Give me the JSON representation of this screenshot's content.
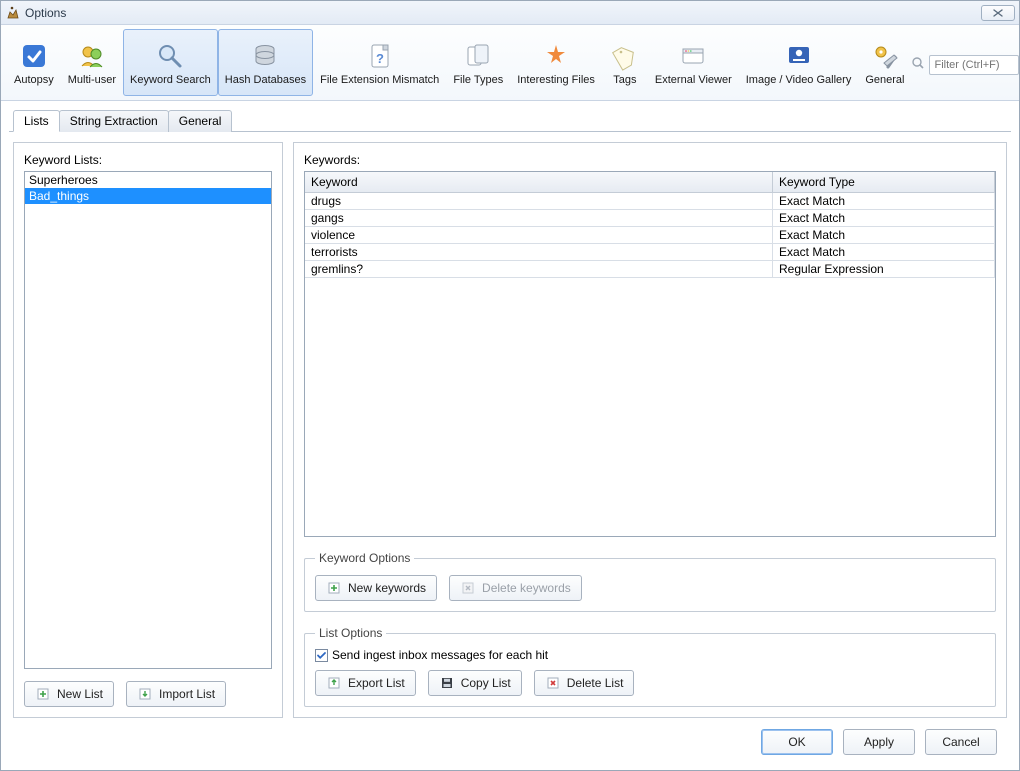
{
  "window": {
    "title": "Options"
  },
  "toolbar": {
    "items": [
      {
        "id": "autopsy",
        "label": "Autopsy"
      },
      {
        "id": "multi-user",
        "label": "Multi-user"
      },
      {
        "id": "keyword-search",
        "label": "Keyword Search"
      },
      {
        "id": "hash-databases",
        "label": "Hash Databases"
      },
      {
        "id": "file-ext-mismatch",
        "label": "File Extension Mismatch"
      },
      {
        "id": "file-types",
        "label": "File Types"
      },
      {
        "id": "interesting-files",
        "label": "Interesting Files"
      },
      {
        "id": "tags",
        "label": "Tags"
      },
      {
        "id": "external-viewer",
        "label": "External Viewer"
      },
      {
        "id": "image-video-gallery",
        "label": "Image / Video Gallery"
      },
      {
        "id": "general",
        "label": "General"
      }
    ],
    "active": "keyword-search",
    "filter_placeholder": "Filter (Ctrl+F)"
  },
  "subtabs": {
    "items": [
      {
        "id": "lists",
        "label": "Lists"
      },
      {
        "id": "string-extraction",
        "label": "String Extraction"
      },
      {
        "id": "general",
        "label": "General"
      }
    ],
    "active": "lists"
  },
  "keyword_lists": {
    "label": "Keyword Lists:",
    "items": [
      {
        "name": "Superheroes",
        "selected": false
      },
      {
        "name": "Bad_things",
        "selected": true
      }
    ],
    "new_list_label": "New List",
    "import_list_label": "Import List"
  },
  "keywords": {
    "label": "Keywords:",
    "headers": {
      "keyword": "Keyword",
      "type": "Keyword Type"
    },
    "rows": [
      {
        "keyword": "drugs",
        "type": "Exact Match"
      },
      {
        "keyword": "gangs",
        "type": "Exact Match"
      },
      {
        "keyword": "violence",
        "type": "Exact Match"
      },
      {
        "keyword": "terrorists",
        "type": "Exact Match"
      },
      {
        "keyword": "gremlins?",
        "type": "Regular Expression"
      }
    ]
  },
  "keyword_options": {
    "legend": "Keyword Options",
    "new_keywords_label": "New keywords",
    "delete_keywords_label": "Delete keywords",
    "delete_keywords_enabled": false
  },
  "list_options": {
    "legend": "List Options",
    "send_inbox_label": "Send ingest inbox messages for each hit",
    "send_inbox_checked": true,
    "export_label": "Export List",
    "copy_label": "Copy List",
    "delete_label": "Delete List"
  },
  "footer": {
    "ok": "OK",
    "apply": "Apply",
    "cancel": "Cancel"
  }
}
